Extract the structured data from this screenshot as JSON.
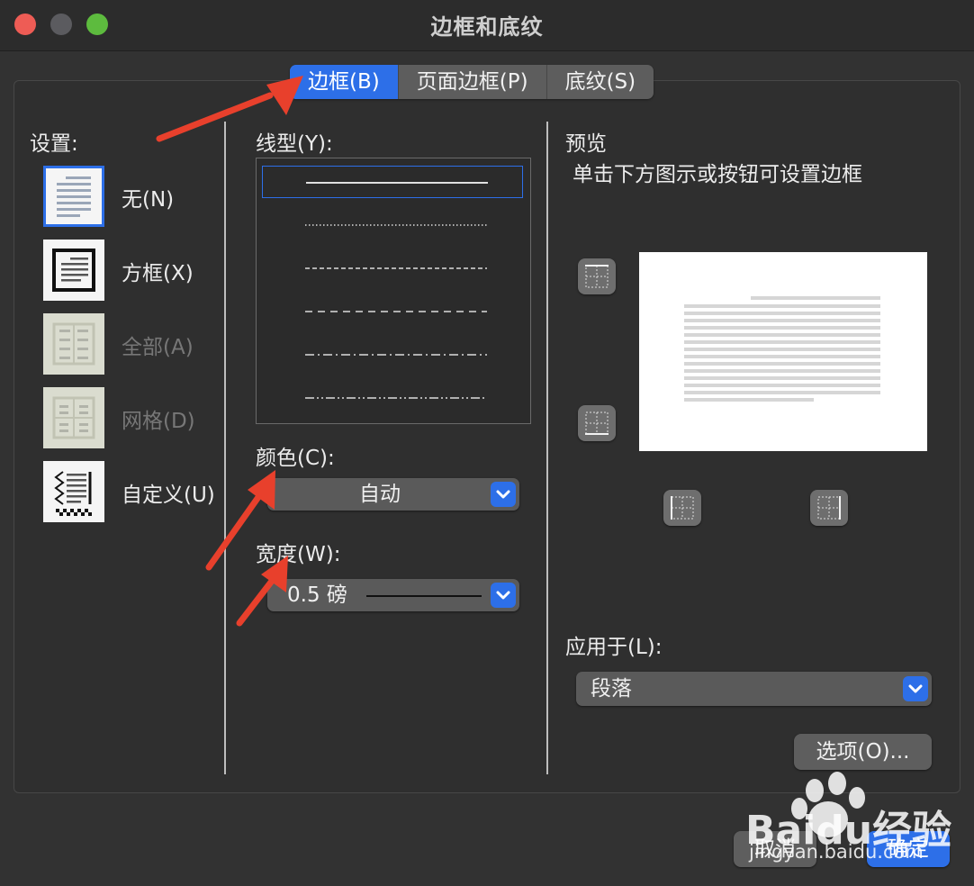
{
  "window": {
    "title": "边框和底纹"
  },
  "tabs": [
    {
      "label": "边框(B)",
      "active": true
    },
    {
      "label": "页面边框(P)",
      "active": false
    },
    {
      "label": "底纹(S)",
      "active": false
    }
  ],
  "settings": {
    "heading": "设置:",
    "items": [
      {
        "label": "无(N)",
        "icon": "none-border-icon",
        "selected": true,
        "enabled": true
      },
      {
        "label": "方框(X)",
        "icon": "box-border-icon",
        "selected": false,
        "enabled": true
      },
      {
        "label": "全部(A)",
        "icon": "all-border-icon",
        "selected": false,
        "enabled": false
      },
      {
        "label": "网格(D)",
        "icon": "grid-border-icon",
        "selected": false,
        "enabled": false
      },
      {
        "label": "自定义(U)",
        "icon": "custom-border-icon",
        "selected": false,
        "enabled": true
      }
    ]
  },
  "style": {
    "heading": "线型(Y):",
    "options": [
      "solid",
      "dotted",
      "dashed-small",
      "dashed",
      "dash-dot",
      "dash-dot-dot"
    ],
    "selected_index": 0
  },
  "color": {
    "label": "颜色(C):",
    "value": "自动"
  },
  "width": {
    "label": "宽度(W):",
    "value": "0.5  磅"
  },
  "preview": {
    "heading": "预览",
    "hint": "单击下方图示或按钮可设置边框"
  },
  "apply_to": {
    "label": "应用于(L):",
    "value": "段落"
  },
  "buttons": {
    "options": "选项(O)...",
    "cancel": "取消",
    "ok": "确定"
  },
  "watermark": {
    "text": "Baidu经验",
    "url": "jingyan.baidu.com"
  },
  "colors": {
    "accent": "#2d6fe8",
    "background": "#323232",
    "annotation_arrow": "#e8402c"
  }
}
